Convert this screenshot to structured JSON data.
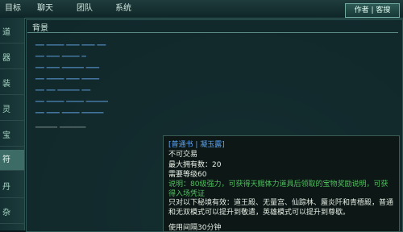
{
  "topbar": {
    "tabs": [
      "目标",
      "聊天",
      "团队",
      "系统"
    ],
    "corner_button": "作者 | 客搜"
  },
  "sidebar": {
    "items": [
      "道",
      "器",
      "装",
      "灵",
      "宝",
      "符",
      "丹",
      "杂"
    ]
  },
  "panel": {
    "title": "背景"
  },
  "tooltip": {
    "item_name": "[普通书 | 凝玉露]",
    "tradeable": "不可交易",
    "max_stack": "最大拥有数：20",
    "level_req": "需要等级60",
    "description": "说明：80级强力，可获得天赐体力道具后领取的宝物奖励说明，可获",
    "description_cont": "得入场凭证",
    "modes": "只对以下秘境有效：道王殿、无量宫、仙踪林、蜃炎阡和青梧殿，普通和无双模式可以提升到敬遣，英雄模式可以提升到尊歇。",
    "duration": "使用间隔30分钟"
  }
}
